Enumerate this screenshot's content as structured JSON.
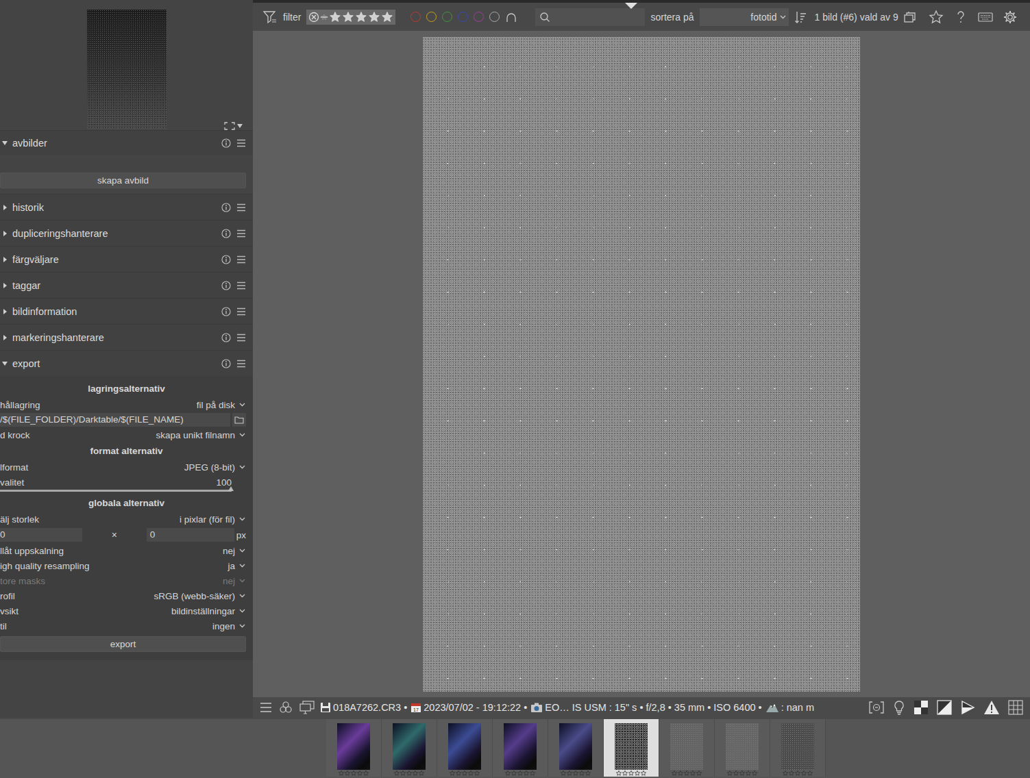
{
  "modules": [
    {
      "name": "avbilder",
      "expanded": true
    },
    {
      "name": "historik",
      "expanded": false
    },
    {
      "name": "dupliceringshanterare",
      "expanded": false
    },
    {
      "name": "färgväljare",
      "expanded": false
    },
    {
      "name": "taggar",
      "expanded": false
    },
    {
      "name": "bildinformation",
      "expanded": false
    },
    {
      "name": "markeringshanterare",
      "expanded": false
    },
    {
      "name": "export",
      "expanded": true
    }
  ],
  "snapshot_button": "skapa avbild",
  "export_rows": [
    {
      "kind": "section",
      "label": "lagringsalternativ"
    },
    {
      "kind": "dropdown",
      "label": "hållagring",
      "value": "fil på disk",
      "disabled": false
    },
    {
      "kind": "path",
      "value": "/$(FILE_FOLDER)/Darktable/$(FILE_NAME)"
    },
    {
      "kind": "dropdown",
      "label": "d krock",
      "value": "skapa unikt filnamn",
      "disabled": false
    },
    {
      "kind": "section",
      "label": "format alternativ"
    },
    {
      "kind": "dropdown",
      "label": "lformat",
      "value": "JPEG (8-bit)",
      "disabled": false
    },
    {
      "kind": "slider",
      "label": "valitet",
      "value": "100",
      "level": 1
    },
    {
      "kind": "section",
      "label": "globala alternativ"
    },
    {
      "kind": "dropdown",
      "label": "älj storlek",
      "value": "i pixlar (för fil)",
      "disabled": false
    },
    {
      "kind": "size",
      "width": "0",
      "times": "×",
      "height": "0",
      "unit": "px"
    },
    {
      "kind": "dropdown",
      "label": "llåt uppskalning",
      "value": "nej",
      "disabled": false
    },
    {
      "kind": "dropdown",
      "label": "igh quality resampling",
      "value": "ja",
      "disabled": false
    },
    {
      "kind": "dropdown",
      "label": "tore masks",
      "value": "nej",
      "disabled": true
    },
    {
      "kind": "dropdown",
      "label": "rofil",
      "value": "sRGB (webb-säker)",
      "disabled": false
    },
    {
      "kind": "dropdown",
      "label": "vsikt",
      "value": "bildinställningar",
      "disabled": false
    },
    {
      "kind": "dropdown",
      "label": "til",
      "value": "ingen",
      "disabled": false
    },
    {
      "kind": "button",
      "label": "export"
    }
  ],
  "toolbar": {
    "filter_label": "filter",
    "color_labels": [
      {
        "color": "#c0392b"
      },
      {
        "color": "#c9a21a"
      },
      {
        "color": "#3a9a3a"
      },
      {
        "color": "#3848b8"
      },
      {
        "color": "#a03ca0"
      },
      {
        "color": "#aaaaaa"
      }
    ],
    "sort_label": "sortera på",
    "sort_value": "fototid",
    "selection_count": "1 bild (#6) vald av 9"
  },
  "image_info": [
    {
      "kind": "file",
      "text": "018A7262.CR3 •"
    },
    {
      "kind": "date",
      "text": "2023/07/02 - 19:12:22 •"
    },
    {
      "kind": "camera",
      "text": "EO… IS USM : 15\" s • f/2,8 • 35 mm • ISO 6400 •"
    },
    {
      "kind": "location",
      "text": ": nan m"
    }
  ],
  "filmstrip": [
    {
      "selected": false,
      "stars": 0,
      "color": "#6a3c9a"
    },
    {
      "selected": false,
      "stars": 0,
      "color": "#2f6a6a"
    },
    {
      "selected": false,
      "stars": 0,
      "color": "#3c4c94"
    },
    {
      "selected": false,
      "stars": 0,
      "color": "#553c8a"
    },
    {
      "selected": false,
      "stars": 0,
      "color": "#4a4c8a"
    },
    {
      "selected": true,
      "stars": 0,
      "color": "#5a5a5a"
    },
    {
      "selected": false,
      "stars": 0,
      "color": "#646464"
    },
    {
      "selected": false,
      "stars": 0,
      "color": "#666666"
    },
    {
      "selected": false,
      "stars": 0,
      "color": "#4c4c4c"
    }
  ]
}
